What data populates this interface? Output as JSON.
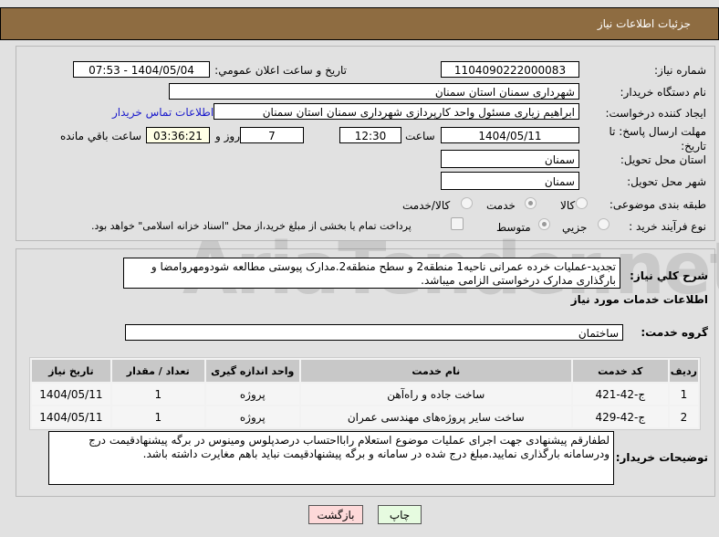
{
  "header": {
    "title": "جزئیات اطلاعات نیاز"
  },
  "form": {
    "need_number_label": "شماره نیاز:",
    "need_number": "1104090222000083",
    "announce_label": "تاریخ و ساعت اعلان عمومي:",
    "announce_value": "1404/05/04 - 07:53",
    "buyer_org_label": "نام دستگاه خریدار:",
    "buyer_org": "شهرداری سمنان استان سمنان",
    "creator_label": "ایجاد کننده درخواست:",
    "creator": "ابراهیم زیاری مسئول واحد کارپردازی شهرداری سمنان استان سمنان",
    "contact_link": "اطلاعات تماس خریدار",
    "deadline_label": "مهلت ارسال پاسخ: تا تاریخ:",
    "deadline_date": "1404/05/11",
    "time_label": "ساعت",
    "deadline_time": "12:30",
    "days": "7",
    "days_label": "روز و",
    "remaining": "03:36:21",
    "remaining_label": "ساعت باقي مانده",
    "province_label": "استان محل تحویل:",
    "province": "سمنان",
    "city_label": "شهر محل تحویل:",
    "city": "سمنان",
    "category_label": "طبقه بندی موضوعی:",
    "category_options": [
      "کالا",
      "خدمت",
      "کالا/خدمت"
    ],
    "category_selected": "خدمت",
    "process_label": "نوع فرآیند خرید :",
    "process_options": [
      "جزیي",
      "متوسط"
    ],
    "process_selected": "متوسط",
    "payment_note": "پرداخت تمام یا بخشی از مبلغ خرید،از محل \"اسناد خزانه اسلامی\" خواهد بود."
  },
  "details": {
    "description_label": "شرح کلي نیاز:",
    "description": "تجدید-عملیات خرده عمرانی ناحیه1 منطقه2 و سطح منطقه2.مدارک پیوستی مطالعه شودومهروامضا و بارگذاری مدارک درخواستی الزامی میباشد.",
    "services_title": "اطلاعات خدمات مورد نیاز",
    "service_group_label": "گروه خدمت:",
    "service_group": "ساختمان",
    "table": {
      "headers": [
        "ردیف",
        "کد خدمت",
        "نام خدمت",
        "واحد اندازه گیری",
        "تعداد / مقدار",
        "تاریخ نیاز"
      ],
      "rows": [
        [
          "1",
          "ج-42-421",
          "ساخت جاده و راه‌آهن",
          "پروژه",
          "1",
          "1404/05/11"
        ],
        [
          "2",
          "ج-42-429",
          "ساخت سایر پروژه‌های مهندسی عمران",
          "پروژه",
          "1",
          "1404/05/11"
        ]
      ]
    },
    "buyer_notes_label": "توضیحات خریدار:",
    "buyer_notes": "لطفارقم پیشنهادی جهت اجرای عملیات موضوع استعلام رابااحتساب درصدپلوس ومینوس در برگه پیشنهادقیمت درج ودرسامانه بارگذاری نمایید.مبلغ درج شده در سامانه و برگه پیشنهادقیمت نباید باهم مغایرت داشته باشد."
  },
  "buttons": {
    "back": "بازگشت",
    "print": "چاپ"
  },
  "watermark": "AriaTender.net"
}
